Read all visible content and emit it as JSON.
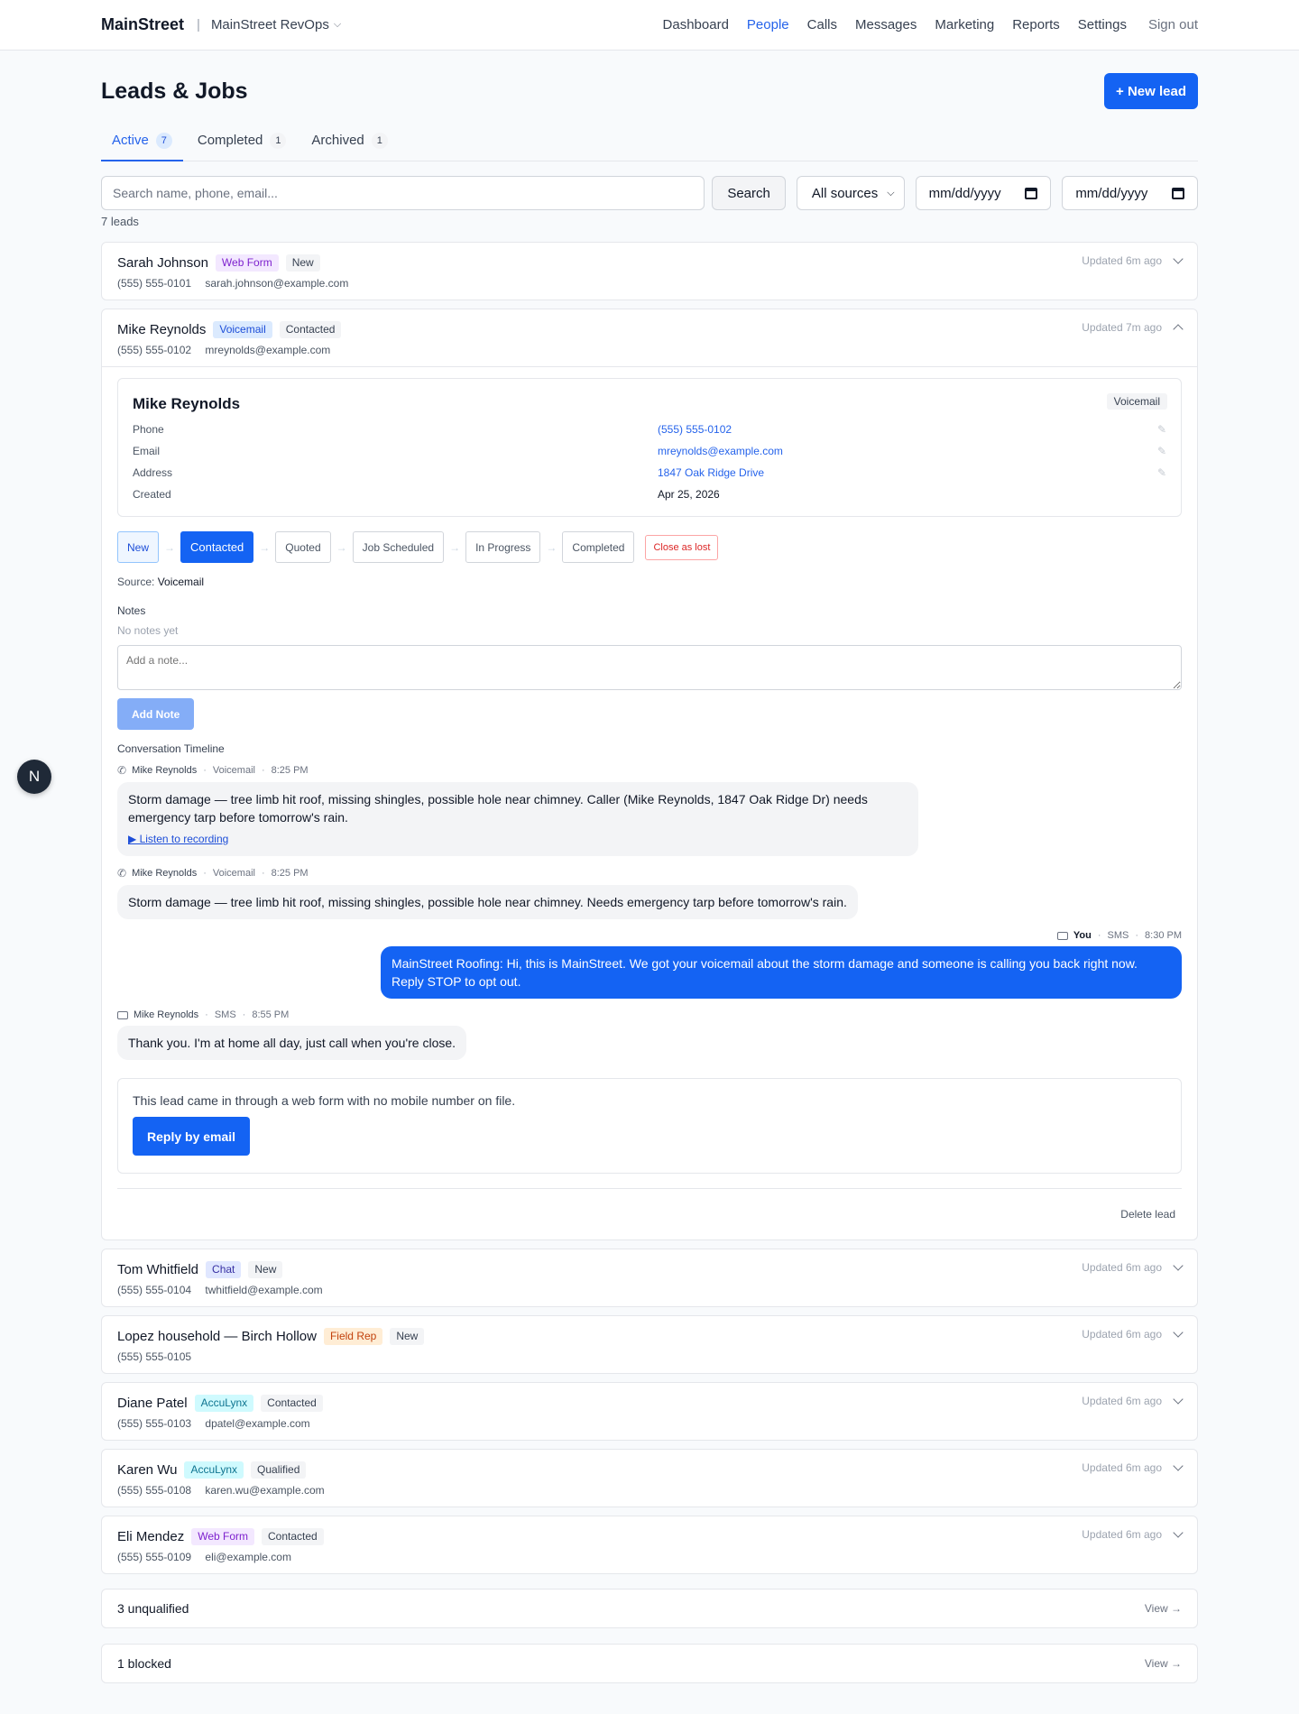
{
  "topbar": {
    "brand": "MainStreet",
    "separator": "|",
    "org": "MainStreet RevOps",
    "nav": [
      {
        "label": "Dashboard"
      },
      {
        "label": "People"
      },
      {
        "label": "Calls"
      },
      {
        "label": "Messages"
      },
      {
        "label": "Marketing"
      },
      {
        "label": "Reports"
      },
      {
        "label": "Settings"
      }
    ],
    "active_nav": "People",
    "signout": "Sign out"
  },
  "page": {
    "title": "Leads & Jobs",
    "new_lead": "+ New lead"
  },
  "tabs": [
    {
      "label": "Active",
      "count": "7"
    },
    {
      "label": "Completed",
      "count": "1"
    },
    {
      "label": "Archived",
      "count": "1"
    }
  ],
  "filters": {
    "search_placeholder": "Search name, phone, email...",
    "search_button": "Search",
    "source": "All sources",
    "date_from": "mm/dd/yyyy",
    "date_to": "mm/dd/yyyy",
    "count_text": "7 leads"
  },
  "leads": [
    {
      "name": "Sarah Johnson",
      "source": "Web Form",
      "status": "New",
      "phone": "(555) 555-0101",
      "email": "sarah.johnson@example.com",
      "updated": "Updated 6m ago"
    },
    {
      "name": "Mike Reynolds",
      "source": "Voicemail",
      "status": "Contacted",
      "phone": "(555) 555-0102",
      "email": "mreynolds@example.com",
      "updated": "Updated 7m ago"
    },
    {
      "name": "Tom Whitfield",
      "source": "Chat",
      "status": "New",
      "phone": "(555) 555-0104",
      "email": "twhitfield@example.com",
      "updated": "Updated 6m ago"
    },
    {
      "name": "Lopez household — Birch Hollow",
      "source": "Field Rep",
      "status": "New",
      "phone": "(555) 555-0105",
      "email": "",
      "updated": "Updated 6m ago"
    },
    {
      "name": "Diane Patel",
      "source": "AccuLynx",
      "status": "Contacted",
      "phone": "(555) 555-0103",
      "email": "dpatel@example.com",
      "updated": "Updated 6m ago"
    },
    {
      "name": "Karen Wu",
      "source": "AccuLynx",
      "status": "Qualified",
      "phone": "(555) 555-0108",
      "email": "karen.wu@example.com",
      "updated": "Updated 6m ago"
    },
    {
      "name": "Eli Mendez",
      "source": "Web Form",
      "status": "Contacted",
      "phone": "(555) 555-0109",
      "email": "eli@example.com",
      "updated": "Updated 6m ago"
    }
  ],
  "detail": {
    "name": "Mike Reynolds",
    "source_badge": "Voicemail",
    "fields": [
      {
        "label": "Phone",
        "value": "(555) 555-0102"
      },
      {
        "label": "Email",
        "value": "mreynolds@example.com"
      },
      {
        "label": "Address",
        "value": "1847 Oak Ridge Drive"
      },
      {
        "label": "Created",
        "value": "Apr 25, 2026"
      }
    ],
    "pipeline": [
      "New",
      "Contacted",
      "Quoted",
      "Job Scheduled",
      "In Progress",
      "Completed"
    ],
    "pipeline_arrow": "→",
    "current_stage": "Contacted",
    "close_lost": "Close as lost",
    "source_label": "Source:",
    "source_value": "Voicemail",
    "notes_label": "Notes",
    "notes_empty": "No notes yet",
    "note_placeholder": "Add a note...",
    "add_note": "Add Note",
    "timeline_label": "Conversation Timeline",
    "messages": [
      {
        "who": "Mike Reynolds",
        "channel": "Voicemail",
        "time": "8:25 PM",
        "text": "Storm damage — tree limb hit roof, missing shingles, possible hole near chimney. Caller (Mike Reynolds, 1847 Oak Ridge Dr) needs emergency tarp before tomorrow's rain.",
        "link": "▶ Listen to recording"
      },
      {
        "who": "Mike Reynolds",
        "channel": "Voicemail",
        "time": "8:25 PM",
        "text": "Storm damage — tree limb hit roof, missing shingles, possible hole near chimney. Needs emergency tarp before tomorrow's rain."
      },
      {
        "who": "You",
        "channel": "SMS",
        "time": "8:30 PM",
        "text": "MainStreet Roofing: Hi, this is MainStreet. We got your voicemail about the storm damage and someone is calling you back right now. Reply STOP to opt out."
      },
      {
        "who": "Mike Reynolds",
        "channel": "SMS",
        "time": "8:55 PM",
        "text": "Thank you. I'm at home all day, just call when you're close."
      }
    ],
    "meta_dot": "·",
    "email_notice": "This lead came in through a web form with no mobile number on file.",
    "reply_email": "Reply by email",
    "delete": "Delete lead"
  },
  "summary": [
    {
      "label": "3 unqualified",
      "action": "View →"
    },
    {
      "label": "1 blocked",
      "action": "View →"
    }
  ],
  "floating_badge": "N",
  "colors": {
    "accent": "#1463f3",
    "link": "#2563eb",
    "background": "#f8fafc"
  }
}
